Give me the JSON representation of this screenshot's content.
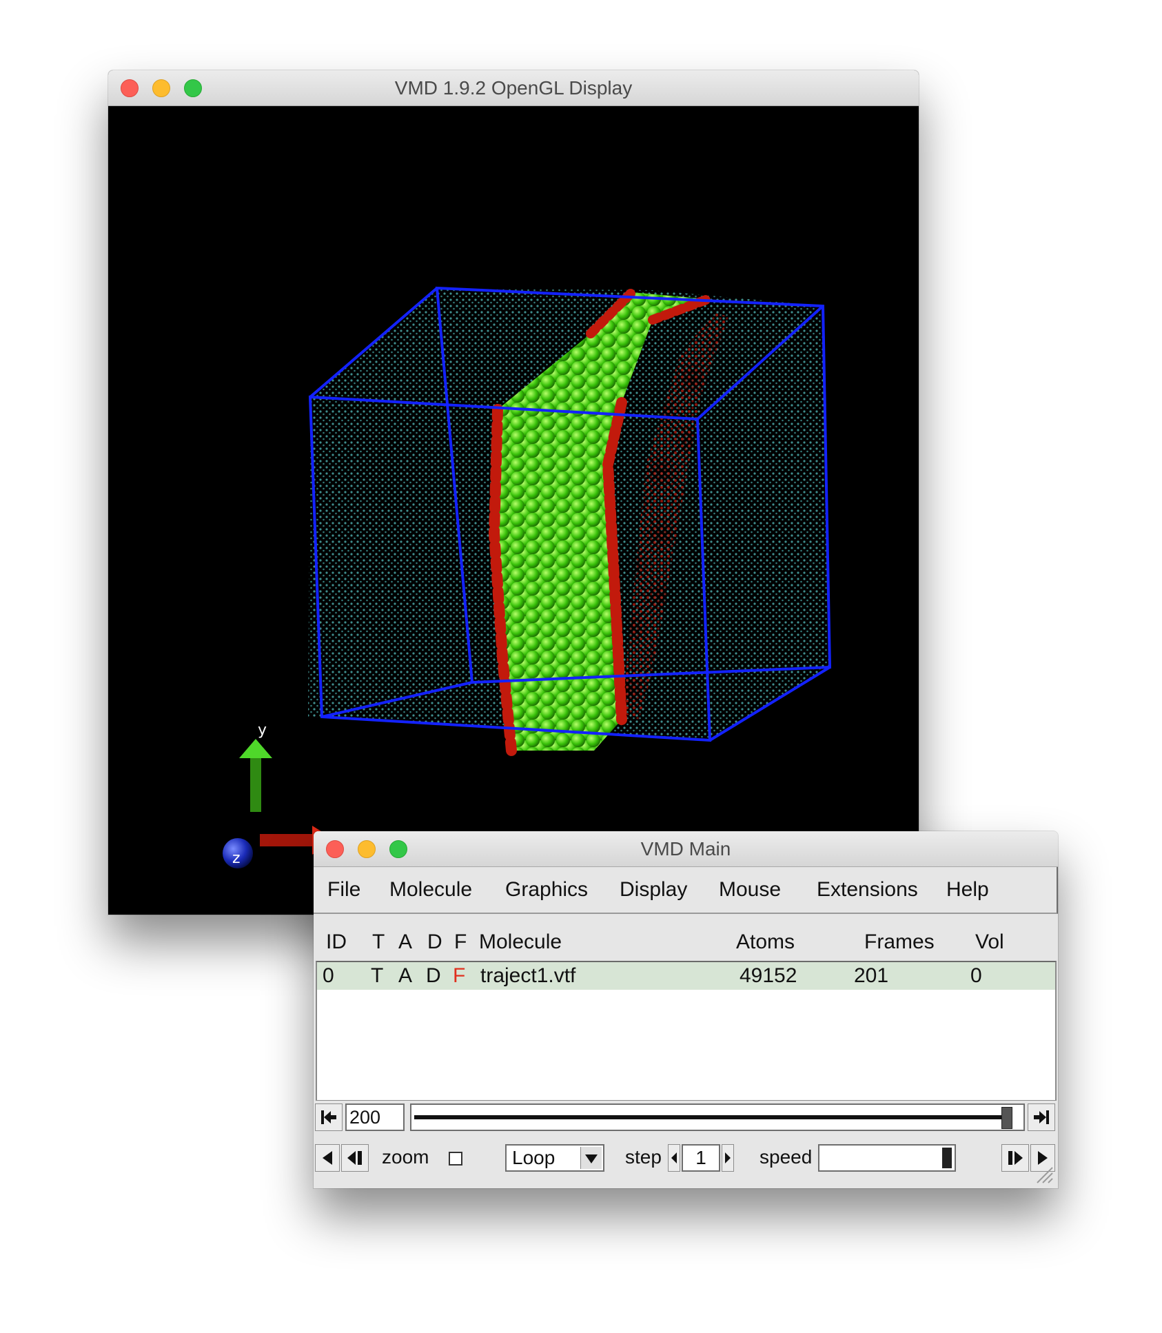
{
  "gl_window": {
    "title": "VMD 1.9.2 OpenGL Display",
    "axes": {
      "x": "x",
      "y": "y",
      "z": "z"
    }
  },
  "main_window": {
    "title": "VMD Main",
    "menu": [
      "File",
      "Molecule",
      "Graphics",
      "Display",
      "Mouse",
      "Extensions",
      "Help"
    ],
    "columns": {
      "id": "ID",
      "t": "T",
      "a": "A",
      "d": "D",
      "f": "F",
      "molecule": "Molecule",
      "atoms": "Atoms",
      "frames": "Frames",
      "vol": "Vol"
    },
    "molecules": [
      {
        "id": "0",
        "t": "T",
        "a": "A",
        "d": "D",
        "f": "F",
        "name": "traject1.vtf",
        "atoms": "49152",
        "frames": "201",
        "vol": "0"
      }
    ],
    "animation": {
      "frame": "200",
      "zoom_label": "zoom",
      "zoom_checked": false,
      "loop_mode": "Loop",
      "step_label": "step",
      "step_value": "1",
      "speed_label": "speed",
      "frame_position": 1.0,
      "speed_level": 1.0
    },
    "colors": {
      "selected_row": "#d7e5d5",
      "frozen_flag": "#e0301e"
    }
  }
}
